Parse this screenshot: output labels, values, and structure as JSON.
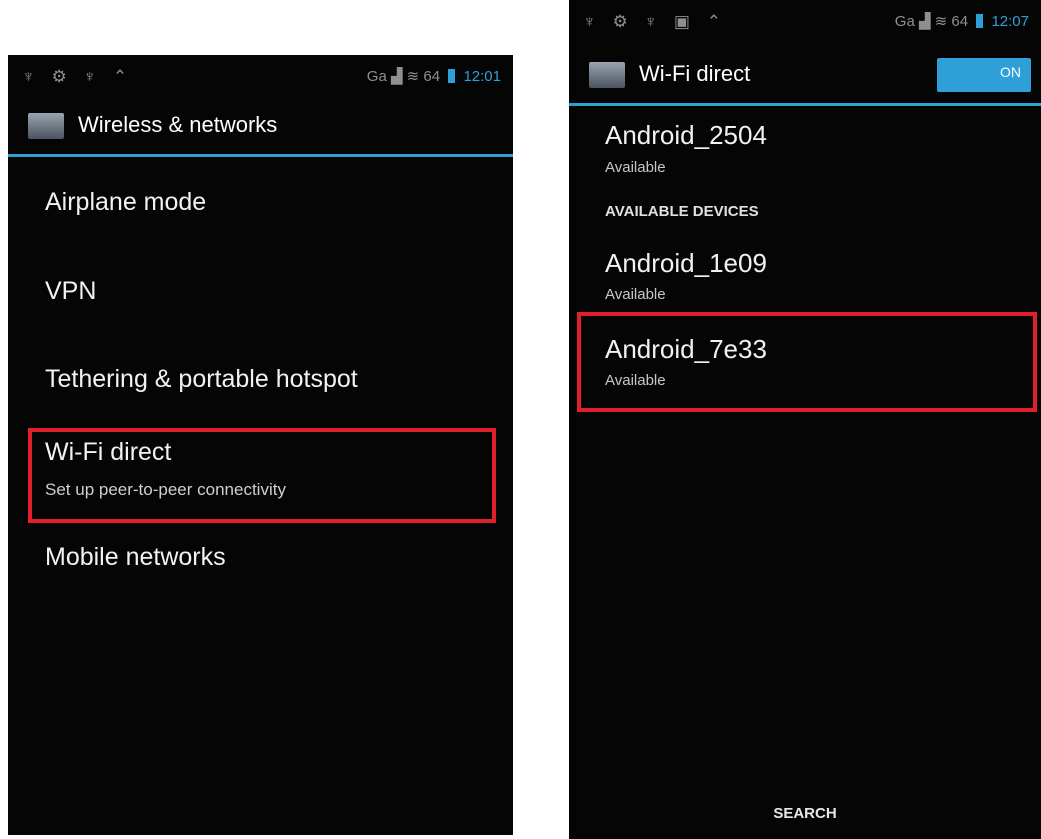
{
  "left": {
    "status": {
      "icons": "♆ ⚙ ♆ ⌃",
      "network": "Ga ▟ ≋ 64",
      "time": "12:01"
    },
    "title": "Wireless & networks",
    "items": [
      {
        "label": "Airplane mode"
      },
      {
        "label": "VPN"
      },
      {
        "label": "Tethering & portable hotspot"
      },
      {
        "label": "Wi-Fi direct",
        "sub": "Set up peer-to-peer connectivity",
        "highlighted": true
      },
      {
        "label": "Mobile networks"
      }
    ]
  },
  "right": {
    "status": {
      "icons": "♆ ⚙ ♆ ▣ ⌃",
      "network": "Ga ▟ ≋ 64",
      "time": "12:07"
    },
    "title": "Wi-Fi direct",
    "toggle": "ON",
    "device_self": {
      "name": "Android_2504",
      "status": "Available"
    },
    "section": "AVAILABLE DEVICES",
    "devices": [
      {
        "name": "Android_1e09",
        "status": "Available"
      },
      {
        "name": "Android_7e33",
        "status": "Available",
        "highlighted": true
      }
    ],
    "search_label": "SEARCH"
  },
  "colors": {
    "accent": "#2aa3cf",
    "highlight": "#e1202b",
    "background": "#050505"
  }
}
